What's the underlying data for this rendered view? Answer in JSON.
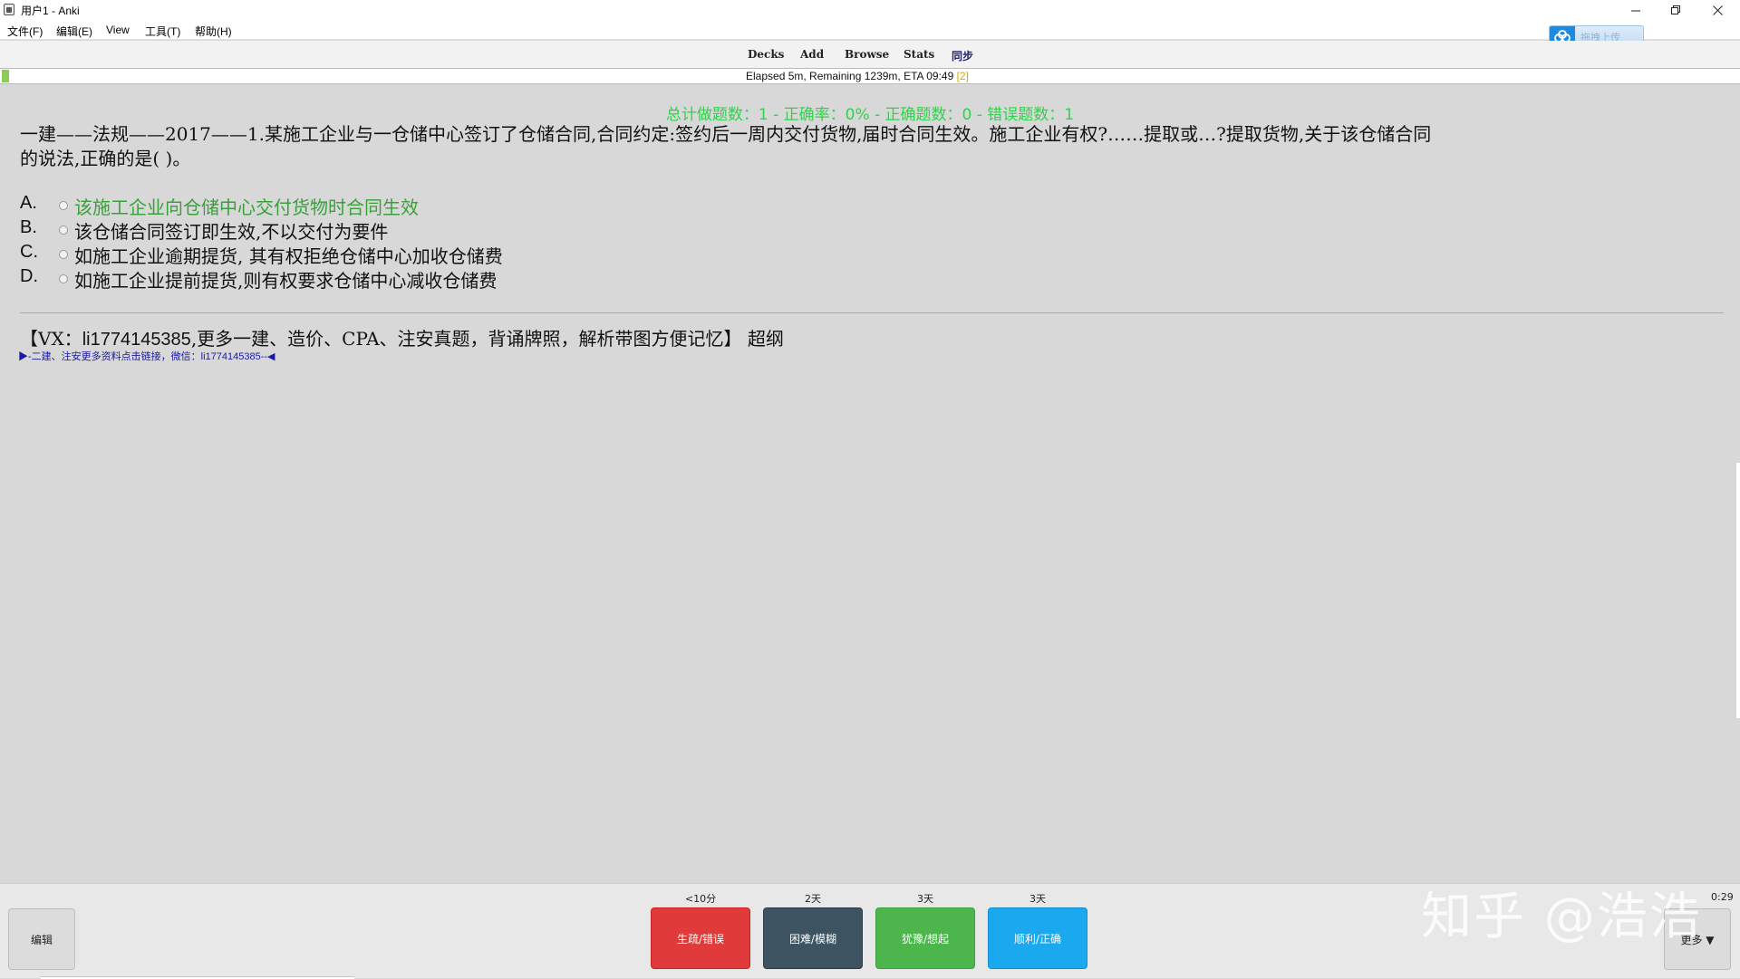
{
  "window": {
    "title": "用户1 - Anki"
  },
  "menubar": {
    "items": [
      {
        "label": "文件(F)"
      },
      {
        "label": "编辑(E)"
      },
      {
        "label": "View"
      },
      {
        "label": "工具(T)"
      },
      {
        "label": "帮助(H)"
      }
    ]
  },
  "upload_widget": {
    "label": "拖拽上传",
    "icon": "cloud-icon"
  },
  "toolbar": {
    "decks": "Decks",
    "add": "Add",
    "browse": "Browse",
    "stats": "Stats",
    "sync": "同步"
  },
  "progress": {
    "text": "Elapsed 5m, Remaining 1239m, ETA 09:49",
    "suffix": "[2]",
    "fill_fraction": 0.004,
    "fill_color": "#8ccb5a"
  },
  "card": {
    "stats_line": "总计做题数：1 - 正确率：0% - 正确题数：0 - 错误题数：1",
    "question_line1": "一建——法规——2017——1.某施工企业与一仓储中心签订了仓储合同,合同约定:签约后一周内交付货物,届时合同生效。施工企业有权?……提取或…?提取货物,关于该仓储合同",
    "question_line2": "的说法,正确的是( )。",
    "options": [
      {
        "letter": "A.",
        "text": "该施工企业向仓储中心交付货物时合同生效",
        "correct": true
      },
      {
        "letter": "B.",
        "text": "该仓储合同签订即生效,不以交付为要件",
        "correct": false
      },
      {
        "letter": "C.",
        "text": "如施工企业逾期提货, 其有权拒绝仓储中心加收仓储费",
        "correct": false
      },
      {
        "letter": "D.",
        "text": "如施工企业提前提货,则有权要求仓储中心减收仓储费",
        "correct": false
      }
    ],
    "note_prefix": "【VX：",
    "note_id": "li1774145385",
    "note_rest": ",更多一建、造价、CPA、注安真题，背诵牌照，解析带图方便记忆】 超纲",
    "link_text": "▶-二建、注安更多资料点击链接，微信：li1774145385--◀"
  },
  "colors": {
    "stats_green": "#2fd24a",
    "correct_green": "#39a13a",
    "again_red": "#e03a3a",
    "hard_slate": "#3e5362",
    "good_green": "#4cb64c",
    "easy_blue": "#1aa8ef"
  },
  "bottombar": {
    "edit_label": "编辑",
    "buttons": [
      {
        "time": "<10分",
        "label": "生疏/错误"
      },
      {
        "time": "2天",
        "label": "困难/模糊"
      },
      {
        "time": "3天",
        "label": "犹豫/想起"
      },
      {
        "time": "3天",
        "label": "顺利/正确"
      }
    ],
    "timer": "0:29",
    "more_label": "更多 ▼"
  },
  "watermark": "知乎 @浩浩"
}
